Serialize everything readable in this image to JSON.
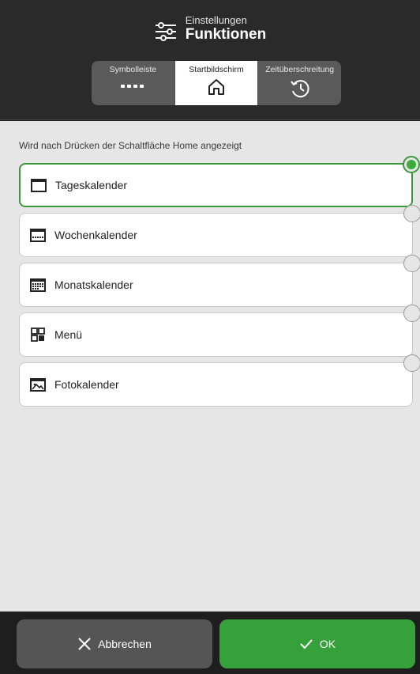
{
  "header": {
    "subtitle": "Einstellungen",
    "title": "Funktionen",
    "icon": "settings-sliders-icon"
  },
  "tabs": [
    {
      "label": "Symbolleiste",
      "icon": "toolbar-dots-icon",
      "active": false
    },
    {
      "label": "Startbildschirm",
      "icon": "home-icon",
      "active": true
    },
    {
      "label": "Zeitüberschreitung",
      "icon": "history-icon",
      "active": false
    }
  ],
  "content": {
    "hint": "Wird nach Drücken der Schaltfläche Home angezeigt",
    "options": [
      {
        "label": "Tageskalender",
        "icon": "day-calendar-icon",
        "selected": true
      },
      {
        "label": "Wochenkalender",
        "icon": "week-calendar-icon",
        "selected": false
      },
      {
        "label": "Monatskalender",
        "icon": "month-calendar-icon",
        "selected": false
      },
      {
        "label": "Menü",
        "icon": "menu-grid-icon",
        "selected": false
      },
      {
        "label": "Fotokalender",
        "icon": "photo-calendar-icon",
        "selected": false
      }
    ]
  },
  "footer": {
    "cancel_label": "Abbrechen",
    "ok_label": "OK"
  },
  "colors": {
    "accent": "#3cab3c",
    "header_bg": "#2a2a2a",
    "content_bg": "#e6e6e6"
  }
}
